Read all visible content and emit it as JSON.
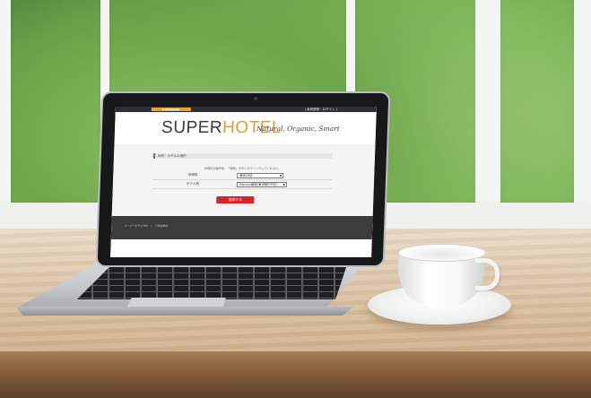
{
  "topbar": {
    "tab_label": "▶ ▶▶▶▶▶▶▶",
    "right_link": "| 会員登録・ログイン |"
  },
  "header": {
    "logo_super": "SUPER",
    "logo_hotel": "HOTEL",
    "tagline": "Natural, Organic, Smart"
  },
  "main": {
    "section_title": "地域・ホテルの選択",
    "instruction": "地域名を選択後、「検索」ボタンをクリックしてください。",
    "rows": [
      {
        "label": "地域名",
        "value": "東京23区"
      },
      {
        "label": "ホテル名",
        "value": "Premier銀座(東京都中央区)"
      }
    ],
    "search_button": "検索する"
  },
  "footer": {
    "links": "スーパーホテルTOP　|　ご利用規約"
  },
  "colors": {
    "brand_orange": "#e59a2b",
    "button_red": "#d4252b",
    "topbar": "#2c2f3a",
    "footer": "#3c3c3c"
  }
}
